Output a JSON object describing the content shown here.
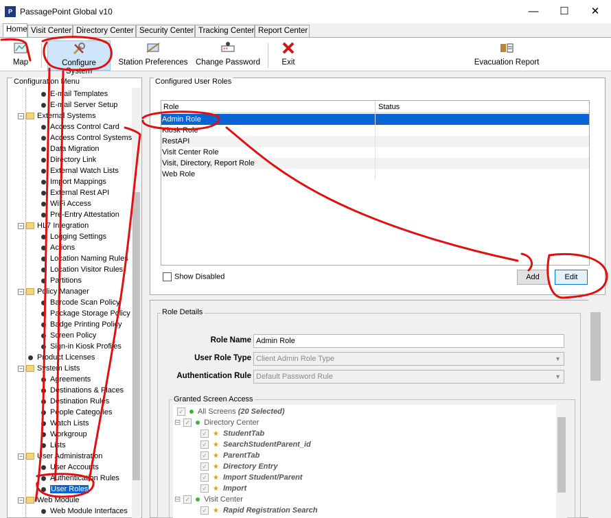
{
  "window": {
    "title": "PassagePoint Global v10",
    "icon_text": "P",
    "minimize_glyph": "—",
    "maximize_glyph": "☐",
    "close_glyph": "✕"
  },
  "tabs": [
    "Home",
    "Visit Center",
    "Directory Center",
    "Security Center",
    "Tracking Center",
    "Report Center"
  ],
  "toolbar": {
    "map": "Map",
    "configure_system": "Configure System",
    "station_preferences": "Station Preferences",
    "change_password": "Change Password",
    "exit": "Exit",
    "evacuation_report": "Evacuation Report"
  },
  "config_menu": {
    "title": "Configuration Menu",
    "items": [
      "E-mail Templates",
      "E-mail Server Setup",
      "External Systems",
      "Access Control Card",
      "Access Control Systems",
      "Data Migration",
      "Directory Link",
      "External Watch Lists",
      "Import Mappings",
      "External Rest API",
      "WiFi Access",
      "Pre-Entry Attestation",
      "HL7 Integration",
      "Logging Settings",
      "Actions",
      "Location Naming Rules",
      "Location Visitor Rules",
      "Partitions",
      "Policy Manager",
      "Barcode Scan Policy",
      "Package Storage Policy",
      "Badge Printing Policy",
      "Screen Policy",
      "Sign-in Kiosk Profiles",
      "Product Licenses",
      "System Lists",
      "Agreements",
      "Destinations & Places",
      "Destination Rules",
      "People Categories",
      "Watch Lists",
      "Workgroup",
      "Lists",
      "User Administration",
      "User Accounts",
      "Authentication Rules",
      "User Roles",
      "Web Module",
      "Web Module Interfaces"
    ]
  },
  "configured_roles": {
    "title": "Configured User Roles",
    "col_role": "Role",
    "col_status": "Status",
    "rows": [
      "Admin Role",
      "Kiosk Role",
      "RestAPI",
      "Visit Center Role",
      "Visit, Directory, Report Role",
      "Web Role"
    ],
    "show_disabled": "Show Disabled",
    "add": "Add",
    "edit": "Edit"
  },
  "role_details": {
    "title": "Role Details",
    "role_name_label": "Role Name",
    "role_name_value": "Admin Role",
    "user_role_type_label": "User Role Type",
    "user_role_type_value": "Client Admin Role Type",
    "auth_rule_label": "Authentication Rule",
    "auth_rule_value": "Default Password Rule",
    "granted_title": "Granted Screen Access",
    "granted": {
      "all_screens": "All Screens",
      "all_selected": "(20 Selected)",
      "directory_center": "Directory Center",
      "student_tab": "StudentTab",
      "search_student_parent": "SearchStudentParent_id",
      "parent_tab": "ParentTab",
      "directory_entry": "Directory Entry",
      "import_student_parent": "Import Student/Parent",
      "import": "Import",
      "visit_center": "Visit Center",
      "rapid_registration": "Rapid Registration Search"
    }
  },
  "colors": {
    "selection": "#0a64d4",
    "annotation": "#e01010"
  }
}
